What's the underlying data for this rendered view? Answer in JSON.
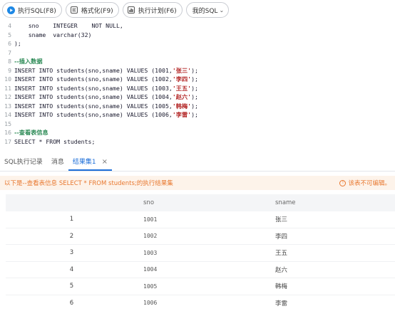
{
  "toolbar": {
    "run_sql": "执行SQL(F8)",
    "format": "格式化(F9)",
    "explain": "执行计划(F6)",
    "my_sql": "我的SQL"
  },
  "editor": {
    "lines": [
      {
        "n": "4",
        "text": "    sno    INTEGER    NOT NULL,",
        "kind": "code"
      },
      {
        "n": "5",
        "text": "    sname  varchar(32)",
        "kind": "code"
      },
      {
        "n": "6",
        "text": ");",
        "kind": "code"
      },
      {
        "n": "7",
        "text": "",
        "kind": "code"
      },
      {
        "n": "8",
        "text": "--插入数据",
        "kind": "comment"
      },
      {
        "n": "9",
        "text": "INSERT INTO students(sno,sname) VALUES (1001,'张三');",
        "kind": "code"
      },
      {
        "n": "10",
        "text": "INSERT INTO students(sno,sname) VALUES (1002,'李四');",
        "kind": "code"
      },
      {
        "n": "11",
        "text": "INSERT INTO students(sno,sname) VALUES (1003,'王五');",
        "kind": "code"
      },
      {
        "n": "12",
        "text": "INSERT INTO students(sno,sname) VALUES (1004,'赵六');",
        "kind": "code"
      },
      {
        "n": "13",
        "text": "INSERT INTO students(sno,sname) VALUES (1005,'韩梅');",
        "kind": "code"
      },
      {
        "n": "14",
        "text": "INSERT INTO students(sno,sname) VALUES (1006,'李雷');",
        "kind": "code"
      },
      {
        "n": "15",
        "text": "",
        "kind": "code"
      },
      {
        "n": "16",
        "text": "--查看表信息",
        "kind": "comment"
      },
      {
        "n": "17",
        "text": "SELECT * FROM students;",
        "kind": "code"
      }
    ]
  },
  "tabs": {
    "log": "SQL执行记录",
    "messages": "消息",
    "result": "结果集1"
  },
  "info": {
    "message": "以下是--查看表信息 SELECT * FROM students;的执行结果集",
    "readonly": "该表不可编辑。"
  },
  "table": {
    "columns": [
      "",
      "sno",
      "sname"
    ],
    "rows": [
      [
        "1",
        "1001",
        "张三"
      ],
      [
        "2",
        "1002",
        "李四"
      ],
      [
        "3",
        "1003",
        "王五"
      ],
      [
        "4",
        "1004",
        "赵六"
      ],
      [
        "5",
        "1005",
        "韩梅"
      ],
      [
        "6",
        "1006",
        "李雷"
      ]
    ]
  },
  "colors": {
    "accent": "#1e6fd9",
    "warning": "#e8772e",
    "run_icon": "#1e88e5"
  }
}
